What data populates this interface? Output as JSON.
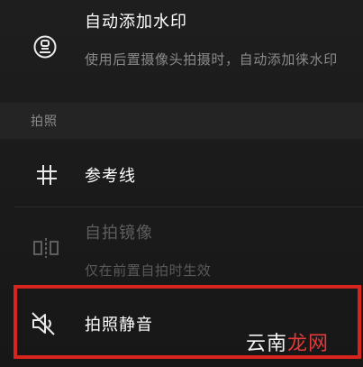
{
  "settings": {
    "watermark_item": {
      "title": "自动添加水印",
      "description": "使用后置摄像头拍摄时，自动添加徕水印",
      "icon": "seal-icon"
    },
    "section_header": "拍照",
    "grid_item": {
      "title": "参考线",
      "icon": "grid-icon"
    },
    "mirror_item": {
      "title": "自拍镜像",
      "description": "仅在前置自拍时生效",
      "icon": "mirror-icon",
      "state": "disabled"
    },
    "mute_item": {
      "title": "拍照静音",
      "icon": "mute-icon"
    }
  },
  "overlay": {
    "highlight_color": "#d8241f",
    "watermark_text_a": "云南",
    "watermark_text_b": "龙网"
  }
}
